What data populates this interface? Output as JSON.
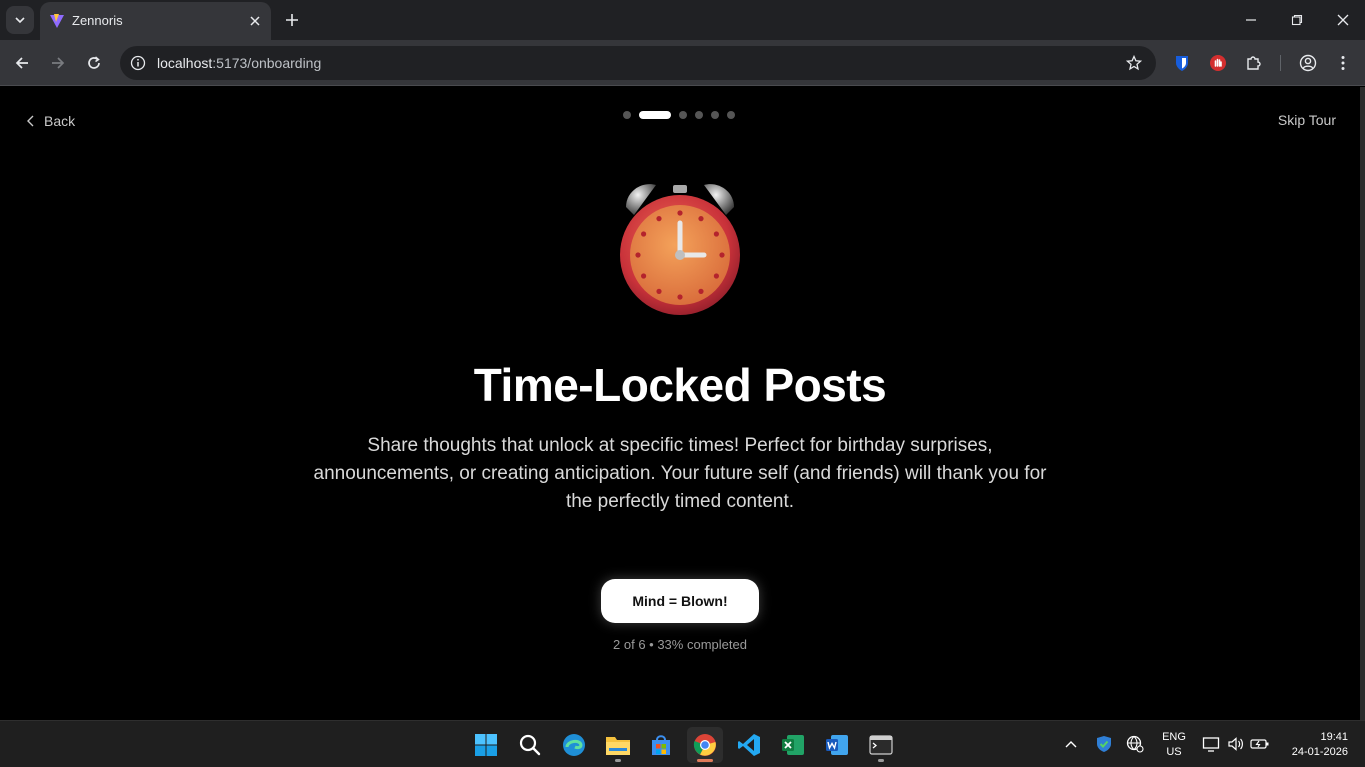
{
  "browser": {
    "tab_title": "Zennoris",
    "url_host": "localhost",
    "url_path": ":5173/onboarding"
  },
  "page": {
    "back_label": "Back",
    "skip_label": "Skip Tour",
    "steps": {
      "total": 6,
      "current": 2
    },
    "title": "Time-Locked Posts",
    "description": "Share thoughts that unlock at specific times! Perfect for birthday surprises, announcements, or creating anticipation. Your future self (and friends) will thank you for the perfectly timed content.",
    "cta_label": "Mind = Blown!",
    "progress_text": "2 of 6 • 33% completed",
    "hero_icon": "alarm-clock-icon"
  },
  "taskbar": {
    "apps": [
      "windows-start-icon",
      "search-icon",
      "edge-icon",
      "file-explorer-icon",
      "store-icon",
      "chrome-icon",
      "vscode-icon",
      "excel-icon",
      "word-icon",
      "terminal-icon"
    ],
    "lang_primary": "ENG",
    "lang_secondary": "US",
    "time": "19:41",
    "date": "24-01-2026"
  },
  "colors": {
    "page_bg": "#000000",
    "chrome_dark": "#202124",
    "chrome_mid": "#35363a",
    "cta_bg": "#ffffff",
    "step_active": "#ffffff",
    "step_inactive": "#555555"
  }
}
